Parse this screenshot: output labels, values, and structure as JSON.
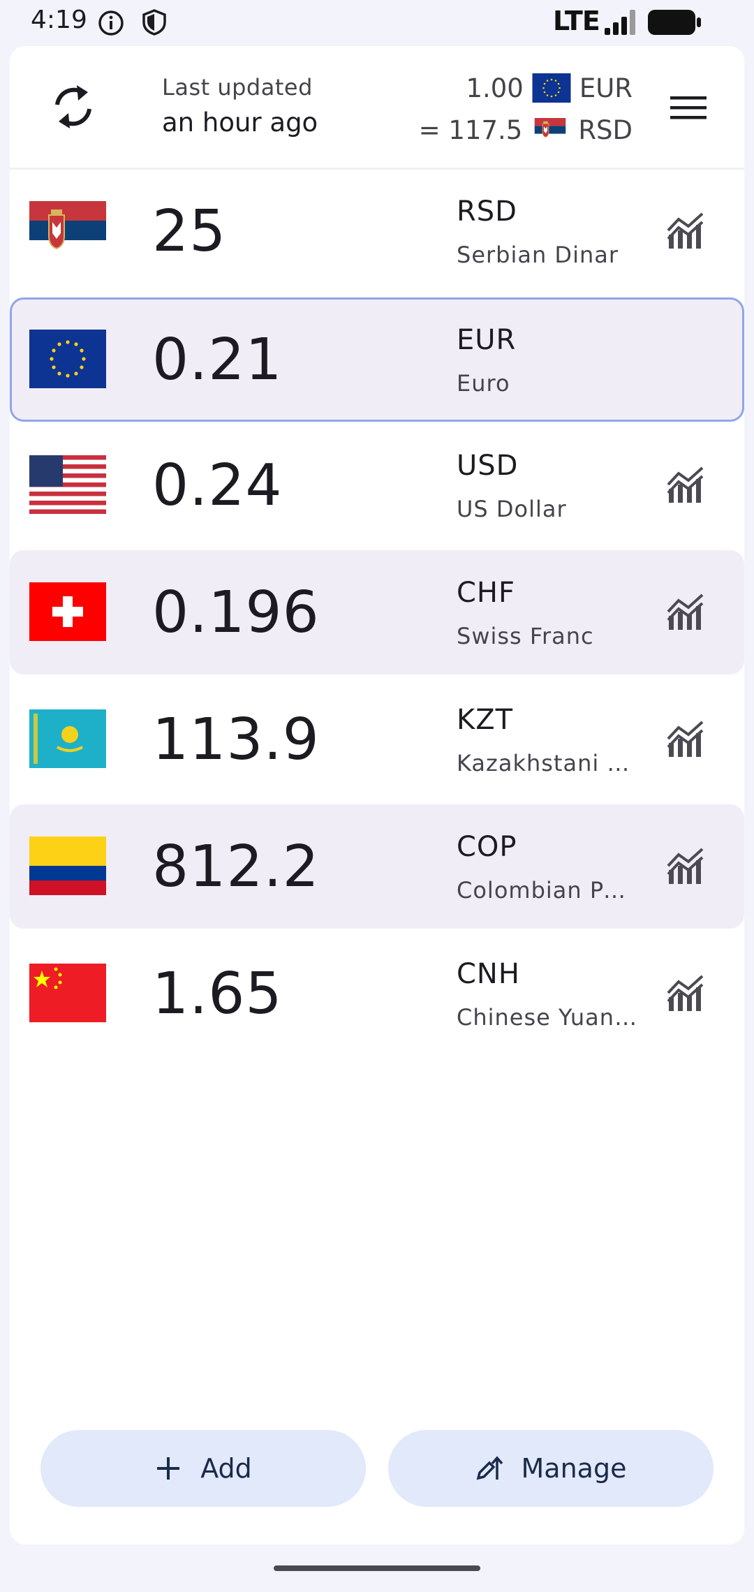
{
  "status_bar": {
    "time": "4:19",
    "network": "LTE"
  },
  "header": {
    "last_updated_label": "Last updated",
    "last_updated_value": "an hour ago",
    "base_amount": "1.00",
    "base_code": "EUR",
    "converted_amount": "= 117.5",
    "converted_code": "RSD"
  },
  "rows": [
    {
      "amount": "25",
      "code": "RSD",
      "name": "Serbian Dinar"
    },
    {
      "amount": "0.21",
      "code": "EUR",
      "name": "Euro"
    },
    {
      "amount": "0.24",
      "code": "USD",
      "name": "US Dollar"
    },
    {
      "amount": "0.196",
      "code": "CHF",
      "name": "Swiss Franc"
    },
    {
      "amount": "113.9",
      "code": "KZT",
      "name": "Kazakhstani Tenge"
    },
    {
      "amount": "812.2",
      "code": "COP",
      "name": "Colombian Peso"
    },
    {
      "amount": "1.65",
      "code": "CNH",
      "name": "Chinese Yuan Renminbi"
    }
  ],
  "buttons": {
    "add_label": "Add",
    "manage_label": "Manage"
  },
  "colors": {
    "accent": "#8fa6e8",
    "button_bg": "#e1e9fa",
    "alt_row": "#f1edf6"
  }
}
